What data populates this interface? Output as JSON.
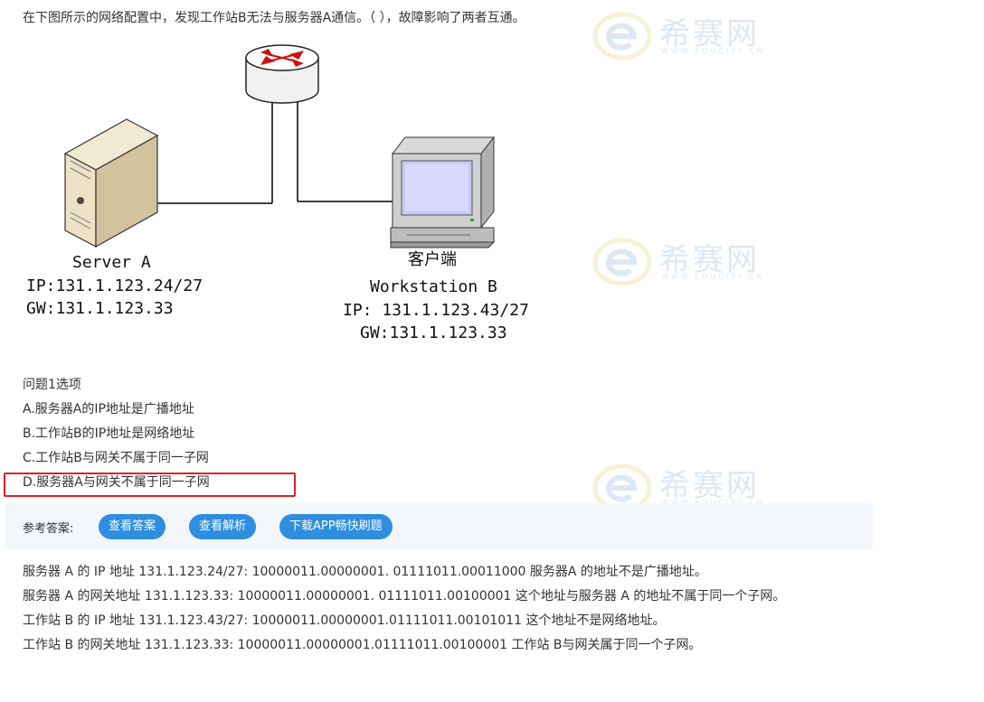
{
  "question": "在下图所示的网络配置中，发现工作站B无法与服务器A通信。（   ），故障影响了两者互通。",
  "watermark": {
    "brand_cn": "希赛网",
    "brand_en": "WWW.EDUCITY.CN"
  },
  "diagram": {
    "server": {
      "name": "Server A",
      "ip": "IP:131.1.123.24/27",
      "gw": "GW:131.1.123.33"
    },
    "workstation": {
      "caption": "客户端",
      "name": "Workstation B",
      "ip": "IP: 131.1.123.43/27",
      "gw": "GW:131.1.123.33"
    }
  },
  "options": {
    "title": "问题1选项",
    "items": [
      "A.服务器A的IP地址是广播地址",
      "B.工作站B的IP地址是网络地址",
      "C.工作站B与网关不属于同一子网",
      "D.服务器A与网关不属于同一子网"
    ]
  },
  "answer_bar": {
    "label": "参考答案:",
    "buttons": [
      "查看答案",
      "查看解析",
      "下载APP畅快刷题"
    ]
  },
  "explanation": [
    "服务器 A 的 IP 地址 131.1.123.24/27: 10000011.00000001. 01111011.00011000 服务器A 的地址不是广播地址。",
    "服务器 A 的网关地址 131.1.123.33:  10000011.00000001. 01111011.00100001 这个地址与服务器 A 的地址不属于同一个子网。",
    "工作站 B 的 IP 地址 131.1.123.43/27: 10000011.00000001.01111011.00101011 这个地址不是网络地址。",
    "工作站 B 的网关地址 131.1.123.33: 10000011.00000001.01111011.00100001 工作站 B与网关属于同一个子网。"
  ],
  "colors": {
    "button": "#2f8ee0",
    "highlight": "#e02020",
    "bar": "#f3f6fa",
    "watermark": "#dde8f2"
  }
}
